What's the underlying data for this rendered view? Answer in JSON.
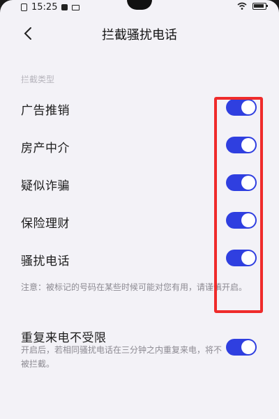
{
  "status_bar": {
    "time": "15:25"
  },
  "header": {
    "title": "拦截骚扰电话"
  },
  "section": {
    "label": "拦截类型"
  },
  "categories": [
    {
      "label": "广告推销",
      "enabled": true
    },
    {
      "label": "房产中介",
      "enabled": true
    },
    {
      "label": "疑似诈骗",
      "enabled": true
    },
    {
      "label": "保险理财",
      "enabled": true
    },
    {
      "label": "骚扰电话",
      "enabled": true
    }
  ],
  "note": "注意：被标记的号码在某些时候可能对您有用，请谨慎开启。",
  "repeat_call": {
    "label": "重复来电不受限",
    "description": "开启后，若相同骚扰电话在三分钟之内重复来电，将不被拦截。",
    "enabled": true
  },
  "colors": {
    "toggle_on": "#2f3fe0",
    "highlight": "#ef2b2b",
    "background": "#f3f2f7"
  },
  "icons": {
    "back": "chevron-left-icon"
  }
}
